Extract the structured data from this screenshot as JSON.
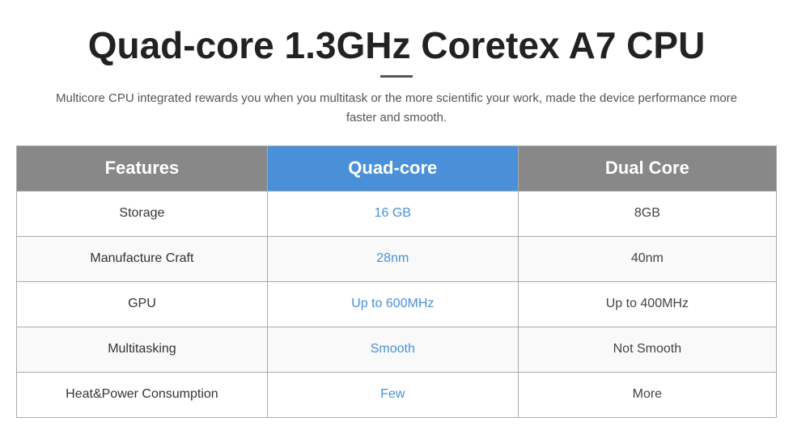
{
  "page": {
    "title": "Quad-core 1.3GHz Coretex A7 CPU",
    "subtitle": "Multicore CPU integrated rewards you when you multitask or the more scientific your work, made the device performance more faster and smooth.",
    "divider": true
  },
  "table": {
    "headers": {
      "features": "Features",
      "quadcore": "Quad-core",
      "dualcore": "Dual Core"
    },
    "rows": [
      {
        "feature": "Storage",
        "quadcore": "16 GB",
        "dualcore": "8GB"
      },
      {
        "feature": "Manufacture Craft",
        "quadcore": "28nm",
        "dualcore": "40nm"
      },
      {
        "feature": "GPU",
        "quadcore": "Up to 600MHz",
        "dualcore": "Up to 400MHz"
      },
      {
        "feature": "Multitasking",
        "quadcore": "Smooth",
        "dualcore": "Not Smooth"
      },
      {
        "feature": "Heat&Power Consumption",
        "quadcore": "Few",
        "dualcore": "More"
      }
    ]
  }
}
